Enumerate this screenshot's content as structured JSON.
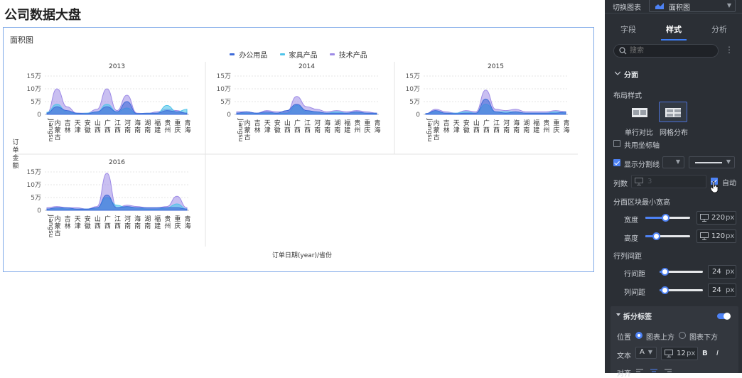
{
  "page": {
    "title": "公司数据大盘"
  },
  "chart_card": {
    "title": "面积图"
  },
  "chart_data": {
    "type": "area",
    "title": "面积图",
    "legend": [
      "办公用品",
      "家具产品",
      "技术产品"
    ],
    "legend_position": "top-center",
    "series_colors": {
      "办公用品": "#3f6bd9",
      "家具产品": "#4fc4ea",
      "技术产品": "#9d8ae6"
    },
    "categories": [
      "Jiangsu",
      "内蒙古",
      "吉林",
      "天津",
      "安徽",
      "山西",
      "广西",
      "江西",
      "河南",
      "海南",
      "湖南",
      "福建",
      "贵州",
      "重庆",
      "青海"
    ],
    "ylabel": "订单金额",
    "xlabel": "订单日期(year)/省份",
    "yticks": [
      "15万",
      "10万",
      "5万",
      "0"
    ],
    "ylim": [
      0,
      150000
    ],
    "facets": [
      {
        "year": "2013",
        "series": [
          {
            "name": "技术产品",
            "values": [
              5000,
              100000,
              30000,
              5000,
              5000,
              20000,
              100000,
              15000,
              75000,
              5000,
              3000,
              10000,
              20000,
              15000,
              5000
            ]
          },
          {
            "name": "家具产品",
            "values": [
              8000,
              40000,
              10000,
              3000,
              5000,
              10000,
              40000,
              10000,
              25000,
              3000,
              3000,
              5000,
              35000,
              10000,
              20000
            ]
          },
          {
            "name": "办公用品",
            "values": [
              5000,
              30000,
              15000,
              5000,
              3000,
              10000,
              30000,
              10000,
              50000,
              3000,
              5000,
              5000,
              15000,
              10000,
              5000
            ]
          }
        ]
      },
      {
        "year": "2014",
        "series": [
          {
            "name": "技术产品",
            "values": [
              10000,
              10000,
              5000,
              15000,
              10000,
              10000,
              70000,
              30000,
              20000,
              10000,
              15000,
              10000,
              15000,
              10000,
              5000
            ]
          },
          {
            "name": "家具产品",
            "values": [
              5000,
              5000,
              3000,
              5000,
              5000,
              5000,
              35000,
              10000,
              10000,
              5000,
              10000,
              5000,
              10000,
              5000,
              3000
            ]
          },
          {
            "name": "办公用品",
            "values": [
              5000,
              10000,
              5000,
              10000,
              5000,
              15000,
              40000,
              15000,
              10000,
              5000,
              5000,
              5000,
              10000,
              5000,
              5000
            ]
          }
        ]
      },
      {
        "year": "2015",
        "series": [
          {
            "name": "技术产品",
            "values": [
              3000,
              20000,
              10000,
              5000,
              15000,
              10000,
              95000,
              20000,
              15000,
              20000,
              10000,
              10000,
              10000,
              15000,
              10000
            ]
          },
          {
            "name": "家具产品",
            "values": [
              3000,
              10000,
              5000,
              5000,
              10000,
              5000,
              40000,
              10000,
              10000,
              10000,
              5000,
              5000,
              5000,
              10000,
              5000
            ]
          },
          {
            "name": "办公用品",
            "values": [
              3000,
              15000,
              5000,
              3000,
              5000,
              5000,
              60000,
              10000,
              5000,
              10000,
              5000,
              5000,
              5000,
              5000,
              10000
            ]
          }
        ]
      },
      {
        "year": "2016",
        "series": [
          {
            "name": "技术产品",
            "values": [
              10000,
              15000,
              10000,
              10000,
              5000,
              15000,
              145000,
              10000,
              20000,
              15000,
              10000,
              10000,
              15000,
              55000,
              10000
            ]
          },
          {
            "name": "家具产品",
            "values": [
              5000,
              10000,
              5000,
              5000,
              5000,
              10000,
              50000,
              20000,
              10000,
              10000,
              5000,
              5000,
              10000,
              25000,
              5000
            ]
          },
          {
            "name": "办公用品",
            "values": [
              5000,
              10000,
              10000,
              5000,
              5000,
              10000,
              60000,
              10000,
              15000,
              10000,
              10000,
              10000,
              10000,
              10000,
              5000
            ]
          }
        ]
      }
    ]
  },
  "panel": {
    "switch_label": "切换图表",
    "chart_type": "面积图",
    "tabs": [
      "字段",
      "样式",
      "分析"
    ],
    "active_tab": "样式",
    "search_placeholder": "搜索",
    "facet_section": "分面",
    "layout_style_label": "布局样式",
    "layout_options": [
      "单行对比",
      "网格分布"
    ],
    "shared_axis_label": "共用坐标轴",
    "show_divider_label": "显示分割线",
    "columns_label": "列数",
    "columns_value": "3",
    "auto_label": "自动",
    "min_size_label": "分面区块最小宽高",
    "width_label": "宽度",
    "width_value": "220",
    "height_label": "高度",
    "height_value": "120",
    "unit_px": "px",
    "spacing_label": "行列间距",
    "row_gap_label": "行间距",
    "row_gap_value": "24",
    "col_gap_label": "列间距",
    "col_gap_value": "24",
    "split_label_section": "拆分标签",
    "position_label": "位置",
    "position_options": [
      "图表上方",
      "图表下方"
    ],
    "text_label": "文本",
    "font_size_value": "12",
    "bold_label": "B",
    "italic_label": "I",
    "align_label": "对齐"
  }
}
